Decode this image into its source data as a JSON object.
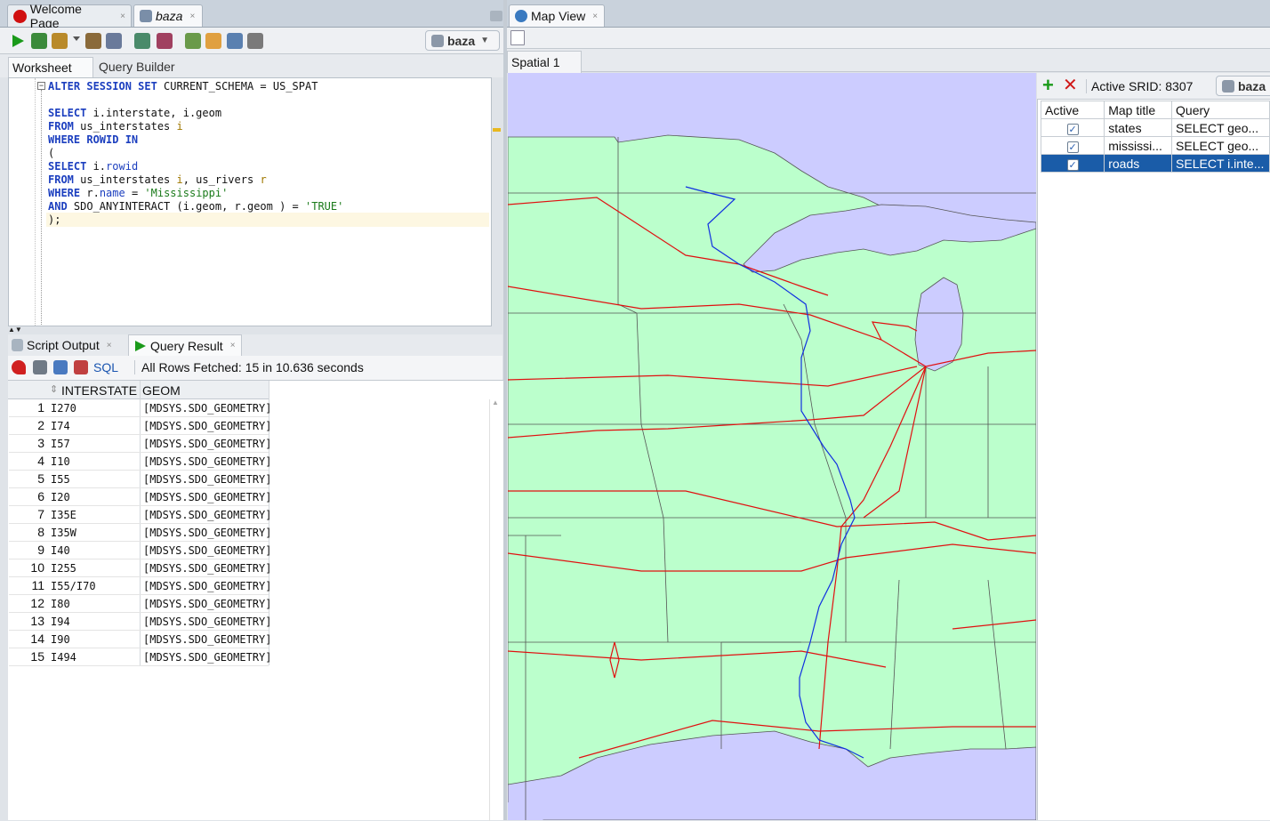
{
  "tabs": {
    "welcome": "Welcome Page",
    "baza": "baza",
    "map_view": "Map View",
    "close": "×"
  },
  "toolbar": {
    "connection": "baza"
  },
  "worksheet_tabs": {
    "worksheet": "Worksheet",
    "query_builder": "Query Builder"
  },
  "sql": {
    "line1": [
      "ALTER SESSION SET",
      " CURRENT_SCHEMA = US_SPAT"
    ],
    "select": "SELECT",
    "select_rest": " i.interstate, i.geom",
    "from": "FROM",
    "from_rest": " us_interstates ",
    "alias_i": "i",
    "where": "WHERE ROWID IN",
    "paren_open": "(",
    "sub_select": "SELECT",
    "sub_select_rest": " i.",
    "rowid": "rowid",
    "sub_from_rest": " us_interstates ",
    "comma_rivers": ", us_rivers ",
    "alias_r": "r",
    "where2": "WHERE",
    "where2_rest_a": " r.",
    "name_col": "name",
    "where2_rest_b": " = ",
    "miss": "'Mississippi'",
    "and": "AND",
    "and_rest": " SDO_ANYINTERACT (i.geom, r.geom ) = ",
    "true_str": "'TRUE'",
    "close": ");"
  },
  "output_tabs": {
    "script_output": "Script Output",
    "query_result": "Query Result"
  },
  "result_bar": {
    "sql_link": "SQL",
    "status": "All Rows Fetched: 15 in 10.636 seconds"
  },
  "grid": {
    "columns": [
      "INTERSTATE",
      "GEOM"
    ],
    "rows": [
      {
        "n": "1",
        "interstate": "I270",
        "geom": "[MDSYS.SDO_GEOMETRY]"
      },
      {
        "n": "2",
        "interstate": "I74",
        "geom": "[MDSYS.SDO_GEOMETRY]"
      },
      {
        "n": "3",
        "interstate": "I57",
        "geom": "[MDSYS.SDO_GEOMETRY]"
      },
      {
        "n": "4",
        "interstate": "I10",
        "geom": "[MDSYS.SDO_GEOMETRY]"
      },
      {
        "n": "5",
        "interstate": "I55",
        "geom": "[MDSYS.SDO_GEOMETRY]"
      },
      {
        "n": "6",
        "interstate": "I20",
        "geom": "[MDSYS.SDO_GEOMETRY]"
      },
      {
        "n": "7",
        "interstate": "I35E",
        "geom": "[MDSYS.SDO_GEOMETRY]"
      },
      {
        "n": "8",
        "interstate": "I35W",
        "geom": "[MDSYS.SDO_GEOMETRY]"
      },
      {
        "n": "9",
        "interstate": "I40",
        "geom": "[MDSYS.SDO_GEOMETRY]"
      },
      {
        "n": "10",
        "interstate": "I255",
        "geom": "[MDSYS.SDO_GEOMETRY]"
      },
      {
        "n": "11",
        "interstate": "I55/I70",
        "geom": "[MDSYS.SDO_GEOMETRY]"
      },
      {
        "n": "12",
        "interstate": "I80",
        "geom": "[MDSYS.SDO_GEOMETRY]"
      },
      {
        "n": "13",
        "interstate": "I94",
        "geom": "[MDSYS.SDO_GEOMETRY]"
      },
      {
        "n": "14",
        "interstate": "I90",
        "geom": "[MDSYS.SDO_GEOMETRY]"
      },
      {
        "n": "15",
        "interstate": "I494",
        "geom": "[MDSYS.SDO_GEOMETRY]"
      }
    ]
  },
  "map": {
    "tab": "Spatial 1",
    "srid_label": "Active SRID: 8307",
    "connection": "baza",
    "layer_headers": [
      "Active",
      "Map title",
      "Query"
    ],
    "layers": [
      {
        "title": "states",
        "query": "SELECT geo...",
        "active": true
      },
      {
        "title": "mississi...",
        "query": "SELECT geo...",
        "active": true
      },
      {
        "title": "roads",
        "query": "SELECT i.inte...",
        "active": true
      }
    ],
    "colors": {
      "water": "#ccccff",
      "land": "#bbffcc",
      "roads": "#e01010",
      "river": "#1030e0",
      "selection": "#1a5ca8"
    }
  }
}
